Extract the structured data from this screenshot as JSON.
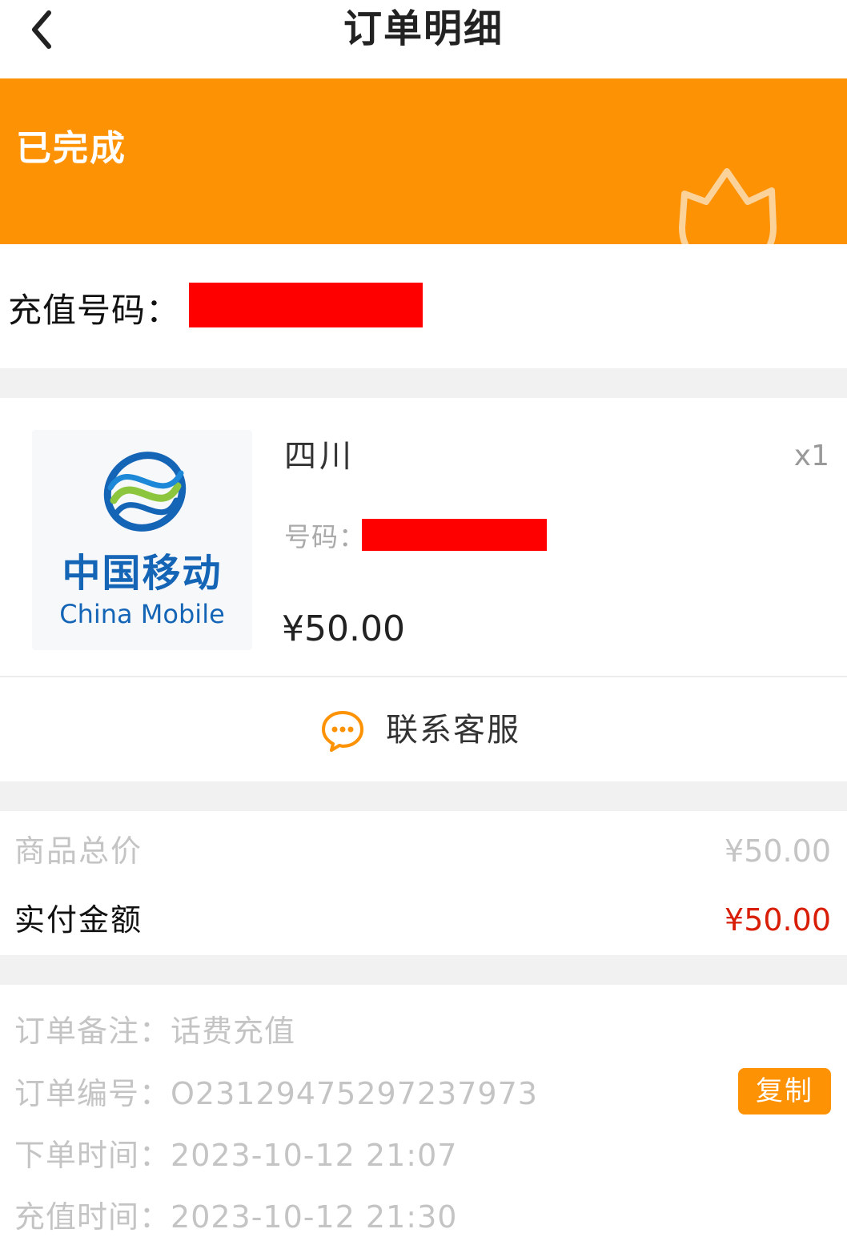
{
  "nav": {
    "title": "订单明细"
  },
  "status": {
    "text": "已完成"
  },
  "recharge": {
    "label": "充值号码："
  },
  "product": {
    "logo_cn": "中国移动",
    "logo_en": "China Mobile",
    "name": "四川",
    "quantity": "x1",
    "number_label": "号码：",
    "price": "¥50.00"
  },
  "service": {
    "label": "联系客服"
  },
  "totals": {
    "goods_total_label": "商品总价",
    "goods_total_value": "¥50.00",
    "paid_label": "实付金额",
    "paid_value": "¥50.00"
  },
  "info": {
    "remark_label": "订单备注：",
    "remark_value": "话费充值",
    "order_no_label": "订单编号：",
    "order_no_value": "O231294752972379 73",
    "order_time_label": "下单时间：",
    "order_time_value": "2023-10-12 21:07",
    "recharge_time_label": "充值时间：",
    "recharge_time_value": "2023-10-12 21:30",
    "copy_label": "复制"
  },
  "colors": {
    "accent": "#fe9205",
    "price_red": "#d81e06",
    "redaction": "#ff0000",
    "brand_blue": "#1565b7",
    "brand_green": "#8cc63f"
  },
  "icons": {
    "back": "chevron-left-icon",
    "status": "tulip-icon",
    "service": "chat-bubble-icon"
  }
}
